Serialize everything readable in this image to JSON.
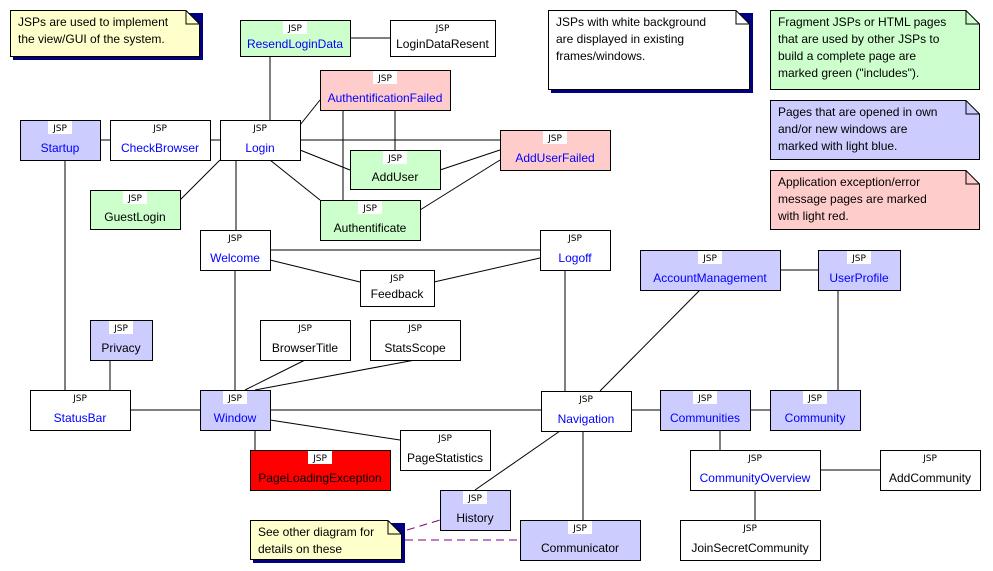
{
  "colors": {
    "white": "#ffffff",
    "include_green": "#ccffcc",
    "window_blue": "#ccccff",
    "error_pink": "#ffcccc",
    "exception_red": "#ff0000",
    "note_yellow": "#ffffcc",
    "link_text": "#0000ff",
    "shadow": "#000080",
    "dashed_link": "#800080"
  },
  "stereotype": "JSP",
  "nodes": [
    {
      "id": "ResendLoginData",
      "label": "ResendLoginData",
      "fill": "include_green",
      "link": true
    },
    {
      "id": "LoginDataResent",
      "label": "LoginDataResent",
      "fill": "white",
      "link": false
    },
    {
      "id": "AuthentificationFailed",
      "label": "AuthentificationFailed",
      "fill": "error_pink",
      "link": true
    },
    {
      "id": "Startup",
      "label": "Startup",
      "fill": "window_blue",
      "link": true
    },
    {
      "id": "CheckBrowser",
      "label": "CheckBrowser",
      "fill": "white",
      "link": true
    },
    {
      "id": "Login",
      "label": "Login",
      "fill": "white",
      "link": true
    },
    {
      "id": "AddUser",
      "label": "AddUser",
      "fill": "include_green",
      "link": false
    },
    {
      "id": "AddUserFailed",
      "label": "AddUserFailed",
      "fill": "error_pink",
      "link": true
    },
    {
      "id": "GuestLogin",
      "label": "GuestLogin",
      "fill": "include_green",
      "link": false
    },
    {
      "id": "Authentificate",
      "label": "Authentificate",
      "fill": "include_green",
      "link": false
    },
    {
      "id": "Welcome",
      "label": "Welcome",
      "fill": "white",
      "link": true
    },
    {
      "id": "Logoff",
      "label": "Logoff",
      "fill": "white",
      "link": true
    },
    {
      "id": "Feedback",
      "label": "Feedback",
      "fill": "white",
      "link": false
    },
    {
      "id": "AccountManagement",
      "label": "AccountManagement",
      "fill": "window_blue",
      "link": true
    },
    {
      "id": "UserProfile",
      "label": "UserProfile",
      "fill": "window_blue",
      "link": true
    },
    {
      "id": "Privacy",
      "label": "Privacy",
      "fill": "window_blue",
      "link": false
    },
    {
      "id": "BrowserTitle",
      "label": "BrowserTitle",
      "fill": "white",
      "link": false
    },
    {
      "id": "StatsScope",
      "label": "StatsScope",
      "fill": "white",
      "link": false
    },
    {
      "id": "StatusBar",
      "label": "StatusBar",
      "fill": "white",
      "link": true
    },
    {
      "id": "Window",
      "label": "Window",
      "fill": "window_blue",
      "link": true
    },
    {
      "id": "Navigation",
      "label": "Navigation",
      "fill": "white",
      "link": true
    },
    {
      "id": "Communities",
      "label": "Communities",
      "fill": "window_blue",
      "link": true
    },
    {
      "id": "Community",
      "label": "Community",
      "fill": "window_blue",
      "link": true
    },
    {
      "id": "PageStatistics",
      "label": "PageStatistics",
      "fill": "white",
      "link": false
    },
    {
      "id": "PageLoadingException",
      "label": "PageLoadingException",
      "fill": "exception_red",
      "link": false
    },
    {
      "id": "CommunityOverview",
      "label": "CommunityOverview",
      "fill": "white",
      "link": true
    },
    {
      "id": "AddCommunity",
      "label": "AddCommunity",
      "fill": "white",
      "link": false
    },
    {
      "id": "History",
      "label": "History",
      "fill": "window_blue",
      "link": false
    },
    {
      "id": "Communicator",
      "label": "Communicator",
      "fill": "window_blue",
      "link": false
    },
    {
      "id": "JoinSecretCommunity",
      "label": "JoinSecretCommunity",
      "fill": "white",
      "link": false
    }
  ],
  "edges": [
    [
      "ResendLoginData",
      "LoginDataResent"
    ],
    [
      "ResendLoginData",
      "Login"
    ],
    [
      "Login",
      "AuthentificationFailed"
    ],
    [
      "Startup",
      "CheckBrowser"
    ],
    [
      "CheckBrowser",
      "Login"
    ],
    [
      "Login",
      "AddUserFailed"
    ],
    [
      "Login",
      "AddUser"
    ],
    [
      "Login",
      "Authentificate"
    ],
    [
      "Login",
      "GuestLogin"
    ],
    [
      "Login",
      "Welcome"
    ],
    [
      "AuthentificationFailed",
      "AddUser"
    ],
    [
      "AuthentificationFailed",
      "Authentificate"
    ],
    [
      "AddUser",
      "AddUserFailed"
    ],
    [
      "Authentificate",
      "AddUserFailed"
    ],
    [
      "Startup",
      "StatusBar"
    ],
    [
      "Welcome",
      "Logoff"
    ],
    [
      "Welcome",
      "Feedback"
    ],
    [
      "Feedback",
      "Logoff"
    ],
    [
      "Welcome",
      "Window"
    ],
    [
      "Logoff",
      "Navigation"
    ],
    [
      "AccountManagement",
      "UserProfile"
    ],
    [
      "AccountManagement",
      "Navigation"
    ],
    [
      "UserProfile",
      "Community"
    ],
    [
      "Privacy",
      "StatusBar"
    ],
    [
      "BrowserTitle",
      "Window"
    ],
    [
      "StatsScope",
      "Window"
    ],
    [
      "StatusBar",
      "Window"
    ],
    [
      "Window",
      "Navigation"
    ],
    [
      "Navigation",
      "Communities"
    ],
    [
      "Communities",
      "Community"
    ],
    [
      "Window",
      "PageStatistics"
    ],
    [
      "Window",
      "PageLoadingException"
    ],
    [
      "Communities",
      "CommunityOverview"
    ],
    [
      "CommunityOverview",
      "AddCommunity"
    ],
    [
      "CommunityOverview",
      "JoinSecretCommunity"
    ],
    [
      "Navigation",
      "History"
    ],
    [
      "Navigation",
      "Communicator"
    ]
  ],
  "dashed_edges": [
    [
      "note-other-diagram",
      "History"
    ],
    [
      "note-other-diagram",
      "Communicator"
    ]
  ],
  "notes": [
    {
      "id": "note-jsp-view",
      "fill": "note_yellow",
      "shadow": true,
      "lines": [
        "JSPs are used to implement",
        "the view/GUI of the system."
      ]
    },
    {
      "id": "note-white",
      "fill": "white",
      "shadow": true,
      "lines": [
        "JSPs with white background",
        "are displayed in existing",
        "frames/windows."
      ]
    },
    {
      "id": "note-green",
      "fill": "include_green",
      "shadow": false,
      "lines": [
        "Fragment JSPs or HTML pages",
        "that are used by other JSPs to",
        "build a complete page are",
        "marked green (\"includes\")."
      ]
    },
    {
      "id": "note-blue",
      "fill": "window_blue",
      "shadow": false,
      "lines": [
        "Pages that are opened in own",
        "and/or new windows are",
        "marked with light blue."
      ]
    },
    {
      "id": "note-red",
      "fill": "error_pink",
      "shadow": false,
      "lines": [
        "Application exception/error",
        "message pages are marked",
        "with light red."
      ]
    },
    {
      "id": "note-other-diagram",
      "fill": "note_yellow",
      "shadow": true,
      "lines": [
        "See other diagram for",
        "details on these"
      ]
    }
  ]
}
